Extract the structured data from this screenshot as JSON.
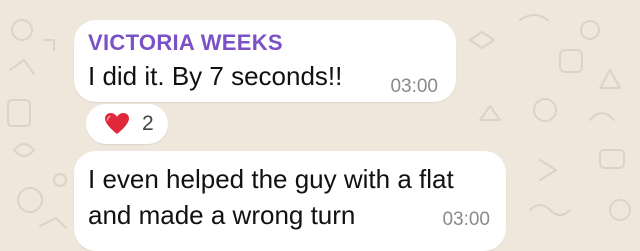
{
  "colors": {
    "background": "#efe7dc",
    "bubble": "#ffffff",
    "sender_name": "#7b52c6",
    "timestamp": "#8a8a8a",
    "heart": "#e0283a"
  },
  "messages": [
    {
      "sender": "VICTORIA WEEKS",
      "text": "I did it. By 7 seconds!!",
      "time": "03:00",
      "reaction": {
        "icon": "red-heart-icon",
        "count": "2"
      }
    },
    {
      "text_lines": [
        "I even helped the guy with a flat",
        "and made a wrong turn"
      ],
      "time": "03:00"
    }
  ]
}
